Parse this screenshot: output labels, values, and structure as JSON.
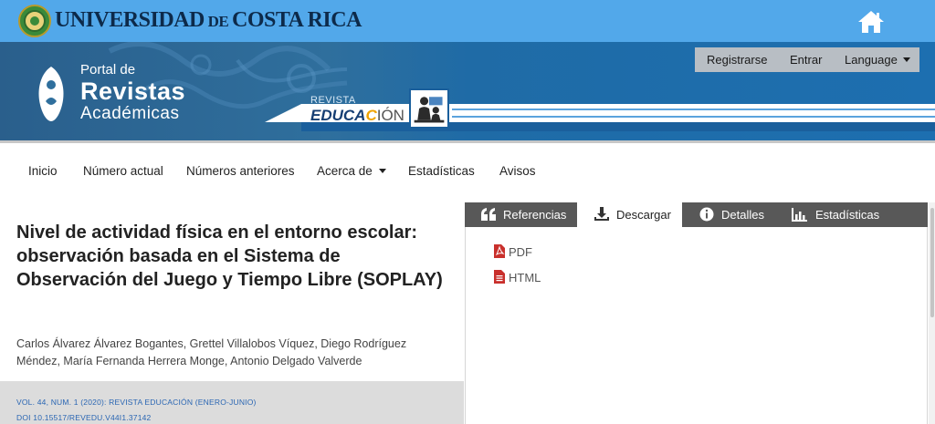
{
  "topbar": {
    "university_name_part1": "UNIVERSIDAD",
    "university_name_part2": " DE ",
    "university_name_part3": "COSTA RICA",
    "home_icon": "home-icon"
  },
  "banner": {
    "portal_small": "Portal de",
    "portal_big": "Revistas",
    "portal_sub": "Académicas",
    "revista_small": "REVISTA",
    "educacion_part1": "EDUCA",
    "educacion_part2": "C",
    "educacion_part3": "IÓN"
  },
  "userbar": {
    "register": "Registrarse",
    "login": "Entrar",
    "language": "Language"
  },
  "nav": {
    "items": [
      "Inicio",
      "Número actual",
      "Números anteriores",
      "Acerca de",
      "Estadísticas",
      "Avisos"
    ]
  },
  "article": {
    "title": "Nivel de actividad física en el entorno escolar: observación basada en el Sistema de Observación del Juego y Tiempo Libre (SOPLAY)",
    "authors": "Carlos Álvarez Álvarez Bogantes, Grettel Villalobos Víquez, Diego Rodríguez Méndez, María Fernanda Herrera Monge, Antonio Delgado Valverde",
    "issue": "VOL. 44, NUM. 1 (2020): REVISTA EDUCACIÓN (ENERO-JUNIO)",
    "doi": "DOI 10.15517/REVEDU.V44I1.37142"
  },
  "tabs": {
    "references": "Referencias",
    "download": "Descargar",
    "details": "Detalles",
    "statistics": "Estadísticas"
  },
  "downloads": {
    "pdf": "PDF",
    "html": "HTML"
  },
  "colors": {
    "topbar": "#52a8ea",
    "tab_dark": "#585858",
    "link_blue": "#2a66b3",
    "pdf_red": "#c9302c"
  }
}
